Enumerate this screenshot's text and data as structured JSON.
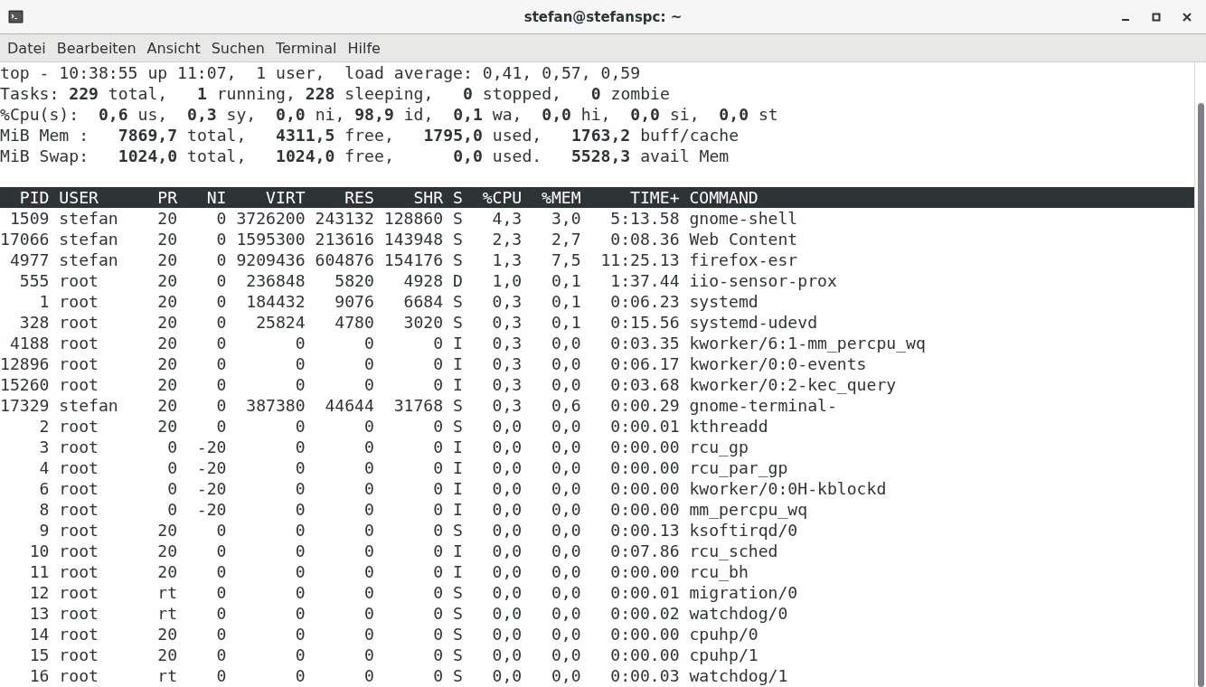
{
  "window": {
    "title": "stefan@stefanspc: ~"
  },
  "menu": [
    "Datei",
    "Bearbeiten",
    "Ansicht",
    "Suchen",
    "Terminal",
    "Hilfe"
  ],
  "summary": [
    "top - 10:38:55 up 11:07,  1 user,  load average: 0,41, 0,57, 0,59",
    "Tasks: **229** total,   **1** running, **228** sleeping,   **0** stopped,   **0** zombie",
    "%Cpu(s):  **0,6** us,  **0,3** sy,  **0,0** ni, **98,9** id,  **0,1** wa,  **0,0** hi,  **0,0** si,  **0,0** st",
    "MiB Mem :   **7869,7** total,   **4311,5** free,   **1795,0** used,   **1763,2** buff/cache",
    "MiB Swap:   **1024,0** total,   **1024,0** free,      **0,0** used.   **5528,3** avail Mem"
  ],
  "table": {
    "columns": [
      "PID",
      "USER",
      "PR",
      "NI",
      "VIRT",
      "RES",
      "SHR",
      "S",
      "%CPU",
      "%MEM",
      "TIME+",
      "COMMAND"
    ],
    "rows": [
      [
        "1509",
        "stefan",
        "20",
        "0",
        "3726200",
        "243132",
        "128860",
        "S",
        "4,3",
        "3,0",
        "5:13.58",
        "gnome-shell"
      ],
      [
        "17066",
        "stefan",
        "20",
        "0",
        "1595300",
        "213616",
        "143948",
        "S",
        "2,3",
        "2,7",
        "0:08.36",
        "Web Content"
      ],
      [
        "4977",
        "stefan",
        "20",
        "0",
        "9209436",
        "604876",
        "154176",
        "S",
        "1,3",
        "7,5",
        "11:25.13",
        "firefox-esr"
      ],
      [
        "555",
        "root",
        "20",
        "0",
        "236848",
        "5820",
        "4928",
        "D",
        "1,0",
        "0,1",
        "1:37.44",
        "iio-sensor-prox"
      ],
      [
        "1",
        "root",
        "20",
        "0",
        "184432",
        "9076",
        "6684",
        "S",
        "0,3",
        "0,1",
        "0:06.23",
        "systemd"
      ],
      [
        "328",
        "root",
        "20",
        "0",
        "25824",
        "4780",
        "3020",
        "S",
        "0,3",
        "0,1",
        "0:15.56",
        "systemd-udevd"
      ],
      [
        "4188",
        "root",
        "20",
        "0",
        "0",
        "0",
        "0",
        "I",
        "0,3",
        "0,0",
        "0:03.35",
        "kworker/6:1-mm_percpu_wq"
      ],
      [
        "12896",
        "root",
        "20",
        "0",
        "0",
        "0",
        "0",
        "I",
        "0,3",
        "0,0",
        "0:06.17",
        "kworker/0:0-events"
      ],
      [
        "15260",
        "root",
        "20",
        "0",
        "0",
        "0",
        "0",
        "I",
        "0,3",
        "0,0",
        "0:03.68",
        "kworker/0:2-kec_query"
      ],
      [
        "17329",
        "stefan",
        "20",
        "0",
        "387380",
        "44644",
        "31768",
        "S",
        "0,3",
        "0,6",
        "0:00.29",
        "gnome-terminal-"
      ],
      [
        "2",
        "root",
        "20",
        "0",
        "0",
        "0",
        "0",
        "S",
        "0,0",
        "0,0",
        "0:00.01",
        "kthreadd"
      ],
      [
        "3",
        "root",
        "0",
        "-20",
        "0",
        "0",
        "0",
        "I",
        "0,0",
        "0,0",
        "0:00.00",
        "rcu_gp"
      ],
      [
        "4",
        "root",
        "0",
        "-20",
        "0",
        "0",
        "0",
        "I",
        "0,0",
        "0,0",
        "0:00.00",
        "rcu_par_gp"
      ],
      [
        "6",
        "root",
        "0",
        "-20",
        "0",
        "0",
        "0",
        "I",
        "0,0",
        "0,0",
        "0:00.00",
        "kworker/0:0H-kblockd"
      ],
      [
        "8",
        "root",
        "0",
        "-20",
        "0",
        "0",
        "0",
        "I",
        "0,0",
        "0,0",
        "0:00.00",
        "mm_percpu_wq"
      ],
      [
        "9",
        "root",
        "20",
        "0",
        "0",
        "0",
        "0",
        "S",
        "0,0",
        "0,0",
        "0:00.13",
        "ksoftirqd/0"
      ],
      [
        "10",
        "root",
        "20",
        "0",
        "0",
        "0",
        "0",
        "I",
        "0,0",
        "0,0",
        "0:07.86",
        "rcu_sched"
      ],
      [
        "11",
        "root",
        "20",
        "0",
        "0",
        "0",
        "0",
        "I",
        "0,0",
        "0,0",
        "0:00.00",
        "rcu_bh"
      ],
      [
        "12",
        "root",
        "rt",
        "0",
        "0",
        "0",
        "0",
        "S",
        "0,0",
        "0,0",
        "0:00.01",
        "migration/0"
      ],
      [
        "13",
        "root",
        "rt",
        "0",
        "0",
        "0",
        "0",
        "S",
        "0,0",
        "0,0",
        "0:00.02",
        "watchdog/0"
      ],
      [
        "14",
        "root",
        "20",
        "0",
        "0",
        "0",
        "0",
        "S",
        "0,0",
        "0,0",
        "0:00.00",
        "cpuhp/0"
      ],
      [
        "15",
        "root",
        "20",
        "0",
        "0",
        "0",
        "0",
        "S",
        "0,0",
        "0,0",
        "0:00.00",
        "cpuhp/1"
      ],
      [
        "16",
        "root",
        "rt",
        "0",
        "0",
        "0",
        "0",
        "S",
        "0,0",
        "0,0",
        "0:00.03",
        "watchdog/1"
      ]
    ]
  }
}
